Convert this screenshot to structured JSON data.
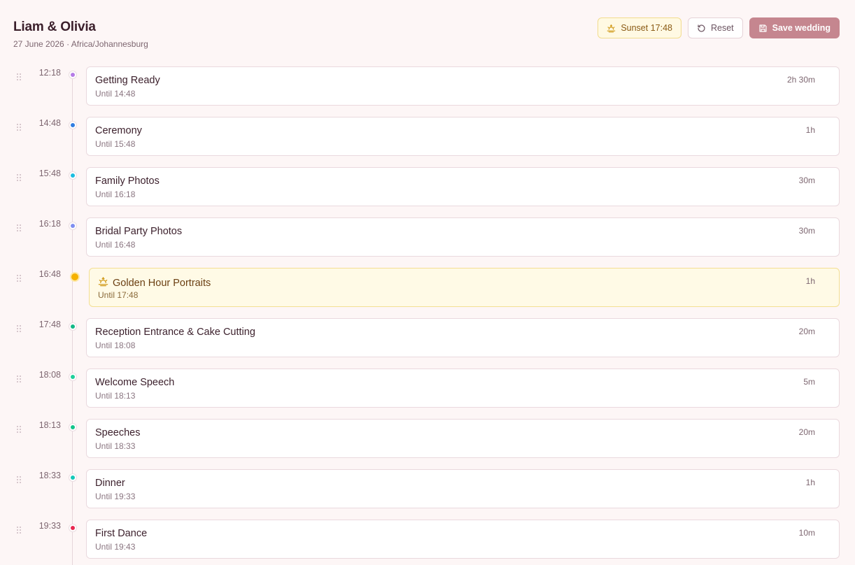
{
  "wedding": {
    "couple": "Liam & Olivia",
    "date_tz": "27 June 2026 · Africa/Johannesburg"
  },
  "toolbar": {
    "sunset_label": "Sunset 17:48",
    "reset_label": "Reset",
    "save_label": "Save wedding"
  },
  "colors": {
    "accent": "#c5868f",
    "golden_bg": "#fffae6",
    "golden_border": "#f3df93"
  },
  "events": [
    {
      "time": "12:18",
      "title": "Getting Ready",
      "until": "Until 14:48",
      "duration": "2h 30m",
      "color": "#b57be6"
    },
    {
      "time": "14:48",
      "title": "Ceremony",
      "until": "Until 15:48",
      "duration": "1h",
      "color": "#2f7de1"
    },
    {
      "time": "15:48",
      "title": "Family Photos",
      "until": "Until 16:18",
      "duration": "30m",
      "color": "#1bbde0"
    },
    {
      "time": "16:18",
      "title": "Bridal Party Photos",
      "until": "Until 16:48",
      "duration": "30m",
      "color": "#7f8ef0"
    },
    {
      "time": "16:48",
      "title": "Golden Hour Portraits",
      "until": "Until 17:48",
      "duration": "1h",
      "color": "#f5b100",
      "golden": true,
      "icon": "sunset-icon"
    },
    {
      "time": "17:48",
      "title": "Reception Entrance & Cake Cutting",
      "until": "Until 18:08",
      "duration": "20m",
      "color": "#12b886"
    },
    {
      "time": "18:08",
      "title": "Welcome Speech",
      "until": "Until 18:13",
      "duration": "5m",
      "color": "#1fcf9a"
    },
    {
      "time": "18:13",
      "title": "Speeches",
      "until": "Until 18:33",
      "duration": "20m",
      "color": "#12c48a"
    },
    {
      "time": "18:33",
      "title": "Dinner",
      "until": "Until 19:33",
      "duration": "1h",
      "color": "#14c8b8"
    },
    {
      "time": "19:33",
      "title": "First Dance",
      "until": "Until 19:43",
      "duration": "10m",
      "color": "#e8274f"
    }
  ]
}
